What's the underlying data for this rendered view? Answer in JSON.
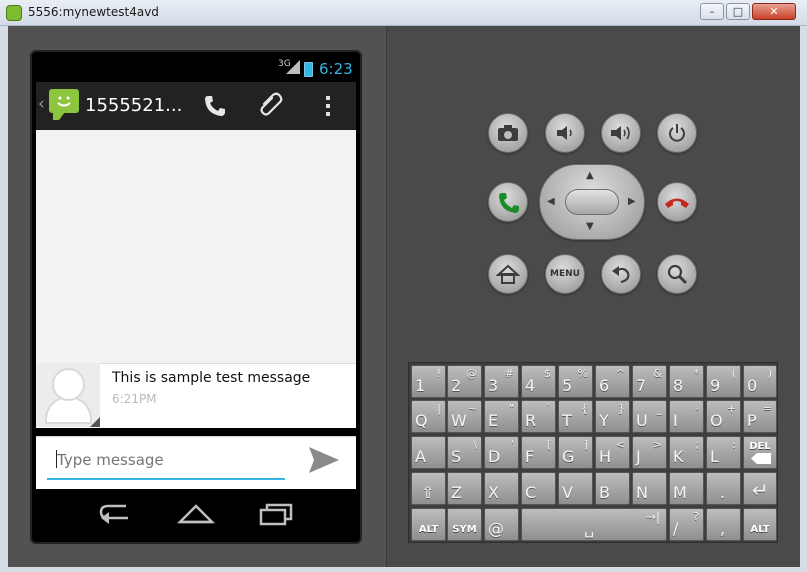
{
  "window": {
    "title": "5556:mynewtest4avd",
    "controls": [
      "minimize",
      "maximize",
      "close"
    ]
  },
  "status_bar": {
    "network": "3G",
    "time": "6:23"
  },
  "conversation": {
    "contact": "1555521...",
    "actions": [
      "call",
      "attach",
      "overflow-menu"
    ],
    "messages": [
      {
        "text": "This is sample test message",
        "time": "6:21PM"
      }
    ],
    "composer_placeholder": "Type message"
  },
  "hardware_buttons": {
    "row1": [
      "camera",
      "volume-down",
      "volume-up",
      "power"
    ],
    "row2": [
      "call",
      "dpad",
      "end-call"
    ],
    "row3": [
      "home",
      "menu",
      "back",
      "search"
    ],
    "menu_label": "MENU"
  },
  "keyboard": {
    "row1": [
      {
        "main": "1",
        "alt": "!"
      },
      {
        "main": "2",
        "alt": "@"
      },
      {
        "main": "3",
        "alt": "#"
      },
      {
        "main": "4",
        "alt": "$"
      },
      {
        "main": "5",
        "alt": "%"
      },
      {
        "main": "6",
        "alt": "^"
      },
      {
        "main": "7",
        "alt": "&"
      },
      {
        "main": "8",
        "alt": "*"
      },
      {
        "main": "9",
        "alt": "("
      },
      {
        "main": "0",
        "alt": ")"
      }
    ],
    "row2": [
      {
        "main": "Q",
        "alt": "|"
      },
      {
        "main": "W",
        "alt": "~"
      },
      {
        "main": "E",
        "alt": "\""
      },
      {
        "main": "R",
        "alt": "`"
      },
      {
        "main": "T",
        "alt": "{"
      },
      {
        "main": "Y",
        "alt": "}"
      },
      {
        "main": "U",
        "alt": "_"
      },
      {
        "main": "I",
        "alt": "-"
      },
      {
        "main": "O",
        "alt": "+"
      },
      {
        "main": "P",
        "alt": "="
      }
    ],
    "row3": [
      {
        "main": "A",
        "alt": ""
      },
      {
        "main": "S",
        "alt": "\\"
      },
      {
        "main": "D",
        "alt": "'"
      },
      {
        "main": "F",
        "alt": "["
      },
      {
        "main": "G",
        "alt": "]"
      },
      {
        "main": "H",
        "alt": "<"
      },
      {
        "main": "J",
        "alt": ">"
      },
      {
        "main": "K",
        "alt": ";"
      },
      {
        "main": "L",
        "alt": ":"
      },
      {
        "main": "DEL",
        "alt": ""
      }
    ],
    "row4": [
      {
        "main": "⇧",
        "alt": ""
      },
      {
        "main": "Z",
        "alt": ""
      },
      {
        "main": "X",
        "alt": ""
      },
      {
        "main": "C",
        "alt": ""
      },
      {
        "main": "V",
        "alt": ""
      },
      {
        "main": "B",
        "alt": ""
      },
      {
        "main": "N",
        "alt": ""
      },
      {
        "main": "M",
        "alt": ""
      },
      {
        "main": ".",
        "alt": ""
      },
      {
        "main": "↵",
        "alt": ""
      }
    ],
    "row5": [
      {
        "main": "ALT",
        "alt": ""
      },
      {
        "main": "SYM",
        "alt": ""
      },
      {
        "main": "@",
        "alt": ""
      },
      {
        "main": "␣",
        "alt": "→|"
      },
      {
        "main": "/",
        "alt": "?"
      },
      {
        "main": ",",
        "alt": ""
      },
      {
        "main": "ALT",
        "alt": ""
      }
    ]
  }
}
